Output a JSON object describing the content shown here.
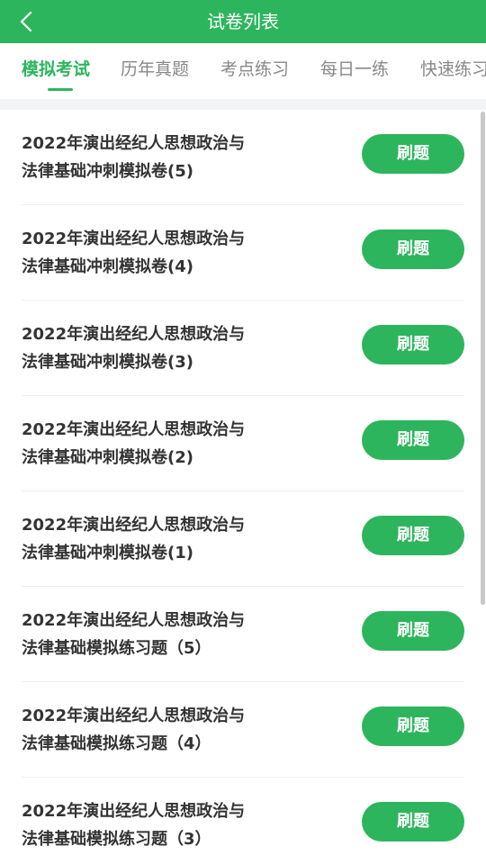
{
  "header": {
    "title": "试卷列表",
    "back_icon": "chevron-left-icon"
  },
  "tabs": [
    {
      "label": "模拟考试",
      "active": true
    },
    {
      "label": "历年真题",
      "active": false
    },
    {
      "label": "考点练习",
      "active": false
    },
    {
      "label": "每日一练",
      "active": false
    },
    {
      "label": "快速练习",
      "active": false
    }
  ],
  "papers": [
    {
      "line1": "2022年演出经纪人思想政治与",
      "line2": "法律基础冲刺模拟卷(5)",
      "button": "刷题"
    },
    {
      "line1": "2022年演出经纪人思想政治与",
      "line2": "法律基础冲刺模拟卷(4)",
      "button": "刷题"
    },
    {
      "line1": "2022年演出经纪人思想政治与",
      "line2": "法律基础冲刺模拟卷(3)",
      "button": "刷题"
    },
    {
      "line1": "2022年演出经纪人思想政治与",
      "line2": "法律基础冲刺模拟卷(2)",
      "button": "刷题"
    },
    {
      "line1": "2022年演出经纪人思想政治与",
      "line2": "法律基础冲刺模拟卷(1)",
      "button": "刷题"
    },
    {
      "line1": "2022年演出经纪人思想政治与",
      "line2": "法律基础模拟练习题（5）",
      "button": "刷题"
    },
    {
      "line1": "2022年演出经纪人思想政治与",
      "line2": "法律基础模拟练习题（4）",
      "button": "刷题"
    },
    {
      "line1": "2022年演出经纪人思想政治与",
      "line2": "法律基础模拟练习题（3）",
      "button": "刷题"
    }
  ],
  "colors": {
    "accent": "#2db55d",
    "title_text": "#333333",
    "inactive_tab": "#888888"
  }
}
